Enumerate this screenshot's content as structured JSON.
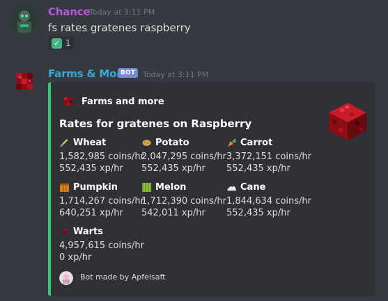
{
  "message1": {
    "username": "Chance",
    "username_color": "#b35bd6",
    "timestamp": "Today at 3:11 PM",
    "content": "fs rates gratenes raspberry",
    "reaction": {
      "emoji": "check-mark-icon",
      "glyph": "✓",
      "count": "1"
    }
  },
  "message2": {
    "username": "Farms & More",
    "username_color": "#3aa9d8",
    "bot_tag": "BOT",
    "timestamp": "Today at 3:11 PM",
    "embed": {
      "accent": "#2ecc71",
      "author": "Farms and more",
      "title": "Rates for gratenes on Raspberry",
      "fields": [
        {
          "name": "Wheat",
          "icon": "wheat-icon",
          "coins": "1,582,985 coins/hr",
          "xp": "552,435 xp/hr"
        },
        {
          "name": "Potato",
          "icon": "potato-icon",
          "coins": "2,047,295 coins/hr",
          "xp": "552,435 xp/hr"
        },
        {
          "name": "Carrot",
          "icon": "carrot-icon",
          "coins": "3,372,151 coins/hr",
          "xp": "552,435 xp/hr"
        },
        {
          "name": "Pumpkin",
          "icon": "pumpkin-icon",
          "coins": "1,714,267 coins/hr",
          "xp": "640,251 xp/hr"
        },
        {
          "name": "Melon",
          "icon": "melon-icon",
          "coins": "1,712,390 coins/hr",
          "xp": "542,011 xp/hr"
        },
        {
          "name": "Cane",
          "icon": "cane-icon",
          "coins": "1,844,634 coins/hr",
          "xp": "552,435 xp/hr"
        },
        {
          "name": "Warts",
          "icon": "warts-icon",
          "coins": "4,957,615 coins/hr",
          "xp": "0 xp/hr"
        }
      ],
      "footer": "Bot made by Apfelsaft"
    }
  }
}
